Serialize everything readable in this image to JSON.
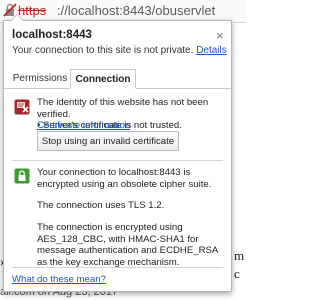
{
  "omnibox": {
    "scheme": "https",
    "url_rest": "://localhost:8443/obuservlet"
  },
  "background": {
    "bullet": "»",
    "letter_m": "m",
    "letter_c": "c",
    "footer": "ail.com on Aug 23, 2017"
  },
  "popup": {
    "host": "localhost:8443",
    "privacy_text": "Your connection to this site is not private.",
    "privacy_link": "Details",
    "close_symbol": "×",
    "tabs": [
      {
        "label": "Permissions",
        "active": false
      },
      {
        "label": "Connection",
        "active": true
      }
    ],
    "identity": {
      "line1": "The identity of this website has not been verified.",
      "line2": "• Server's certificate is not trusted.",
      "cert_link": "Certificate information",
      "stop_button": "Stop using an invalid certificate"
    },
    "connection": {
      "para1": "Your connection to localhost:8443 is encrypted using an obsolete cipher suite.",
      "para2": "The connection uses TLS 1.2.",
      "para3": "The connection is encrypted using AES_128_CBC, with HMAC-SHA1 for message authentication and ECDHE_RSA as the key exchange mechanism."
    },
    "help_link": "What do these mean?"
  },
  "colors": {
    "insecure_red": "#c5221f",
    "link_blue": "#1a55c0",
    "secure_green": "#3c9a2e",
    "warning_red": "#a32a2a"
  },
  "icons": {
    "url_icon": "insecure-lock-icon",
    "identity_icon": "certificate-warning-icon",
    "connection_icon": "lock-icon"
  }
}
